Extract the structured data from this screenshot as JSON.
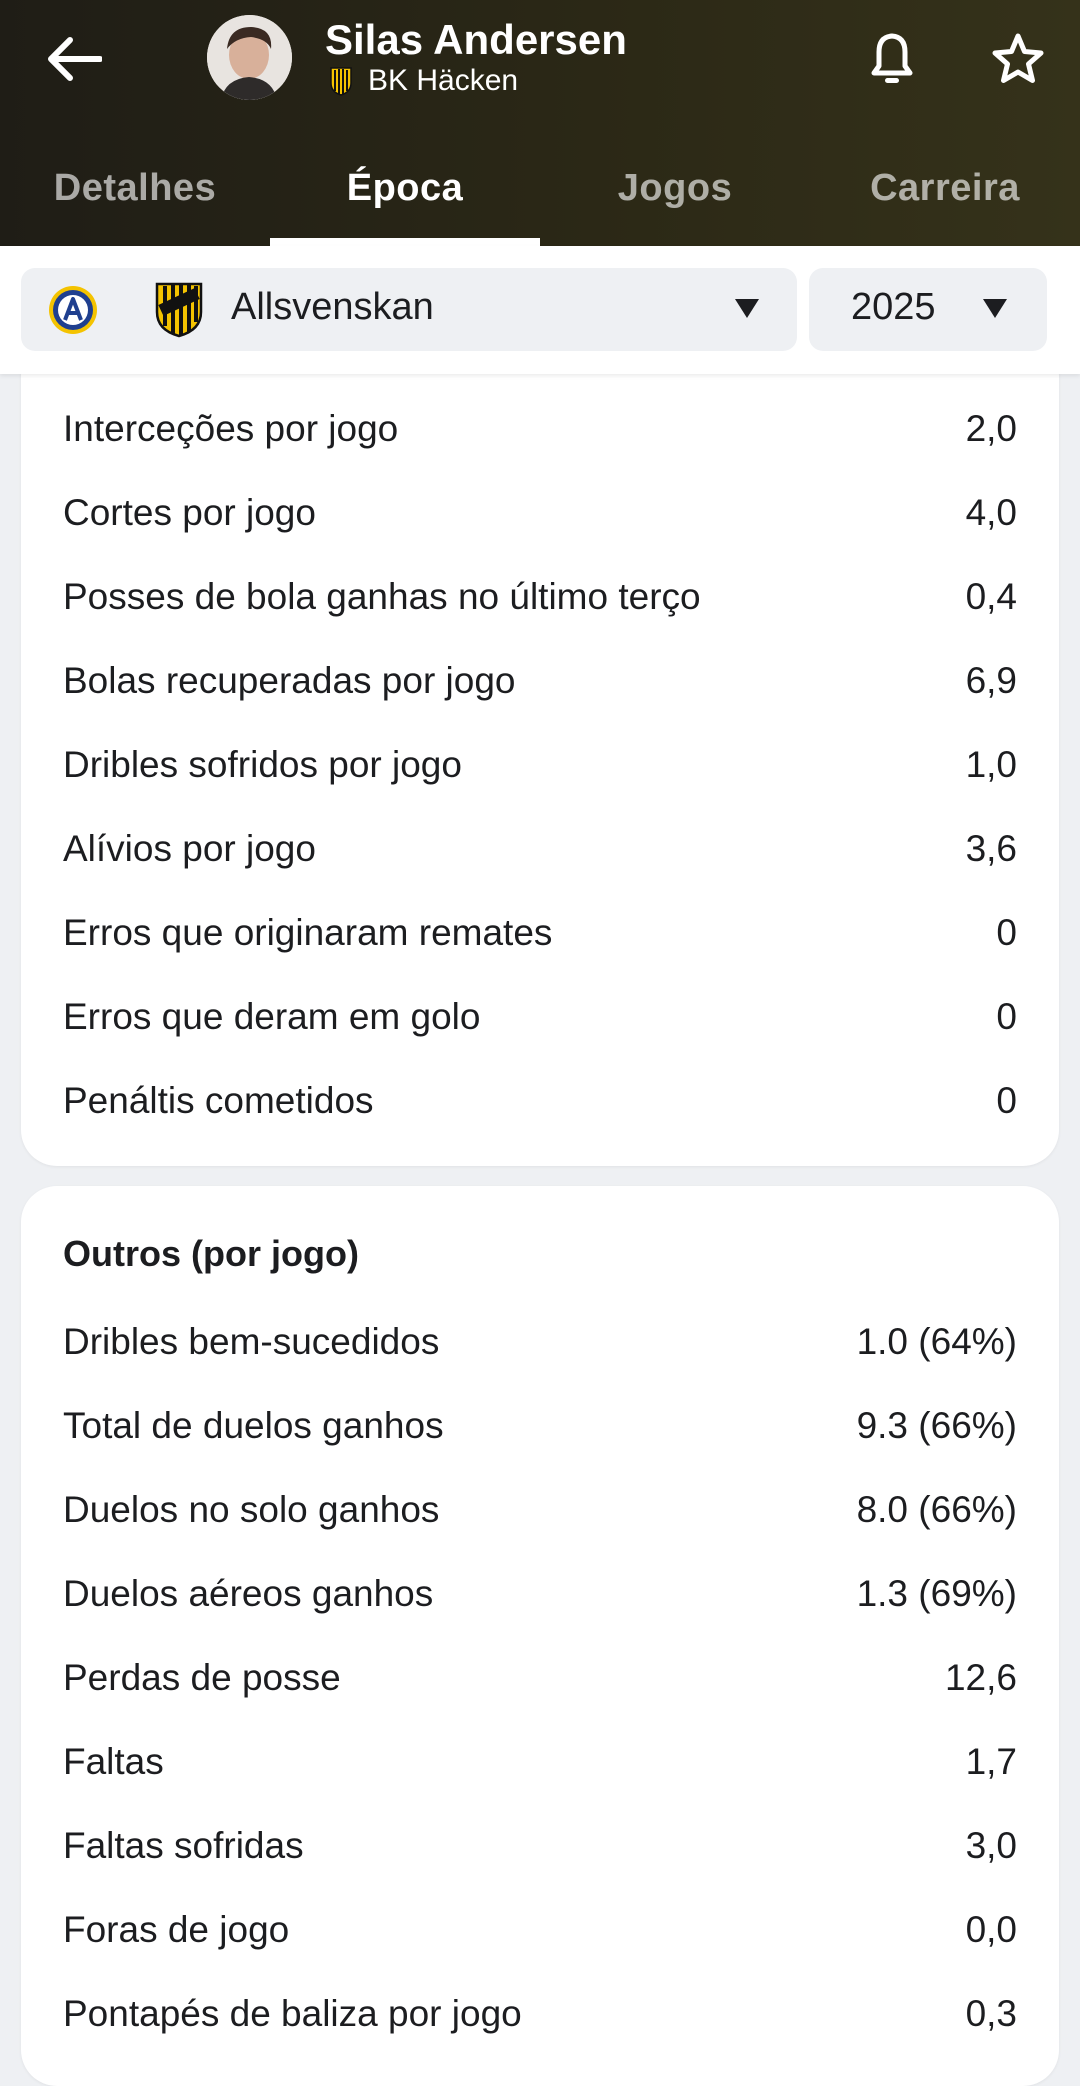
{
  "header": {
    "player_name": "Silas Andersen",
    "team_name": "BK Häcken",
    "icons": {
      "back": "back-arrow-icon",
      "bell": "bell-icon",
      "star": "star-icon"
    }
  },
  "tabs": [
    {
      "label": "Detalhes",
      "active": false
    },
    {
      "label": "Época",
      "active": true
    },
    {
      "label": "Jogos",
      "active": false
    },
    {
      "label": "Carreira",
      "active": false
    }
  ],
  "filters": {
    "league": "Allsvenskan",
    "year": "2025"
  },
  "defending_stats": [
    {
      "label": "Interceções por jogo",
      "value": "2,0"
    },
    {
      "label": "Cortes por jogo",
      "value": "4,0"
    },
    {
      "label": "Posses de bola ganhas no último terço",
      "value": "0,4"
    },
    {
      "label": "Bolas recuperadas por jogo",
      "value": "6,9"
    },
    {
      "label": "Dribles sofridos por jogo",
      "value": "1,0"
    },
    {
      "label": "Alívios por jogo",
      "value": "3,6"
    },
    {
      "label": "Erros que originaram remates",
      "value": "0"
    },
    {
      "label": "Erros que deram em golo",
      "value": "0"
    },
    {
      "label": "Penáltis cometidos",
      "value": "0"
    }
  ],
  "other_section": {
    "title": "Outros (por jogo)",
    "stats": [
      {
        "label": "Dribles bem-sucedidos",
        "value": "1.0 (64%)"
      },
      {
        "label": "Total de duelos ganhos",
        "value": "9.3 (66%)"
      },
      {
        "label": "Duelos no solo ganhos",
        "value": "8.0 (66%)"
      },
      {
        "label": "Duelos aéreos ganhos",
        "value": "1.3 (69%)"
      },
      {
        "label": "Perdas de posse",
        "value": "12,6"
      },
      {
        "label": "Faltas",
        "value": "1,7"
      },
      {
        "label": "Faltas sofridas",
        "value": "3,0"
      },
      {
        "label": "Foras de jogo",
        "value": "0,0"
      },
      {
        "label": "Pontapés de baliza por jogo",
        "value": "0,3"
      }
    ]
  },
  "colors": {
    "header_bg": "#2b2816",
    "page_bg": "#eef0f3",
    "card_bg": "#ffffff",
    "club_yellow": "#f4c300"
  }
}
